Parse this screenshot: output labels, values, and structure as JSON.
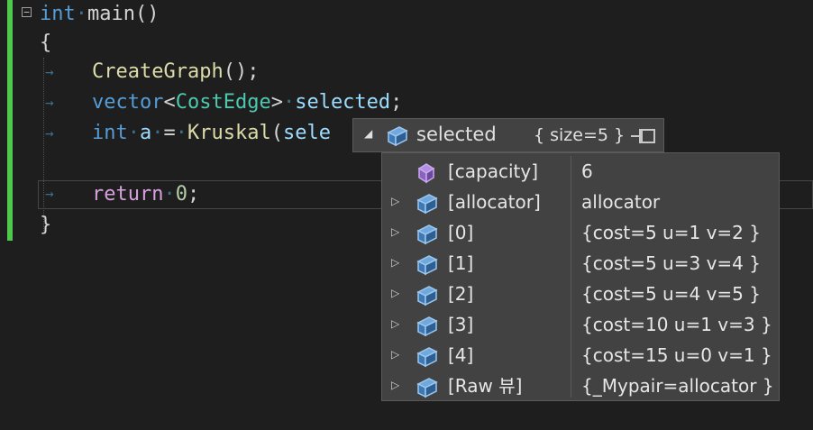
{
  "code": {
    "line1": {
      "kw": "int",
      "rest": "main()"
    },
    "line2": {
      "brace": "{"
    },
    "line3": {
      "call": "CreateGraph",
      "rest": "();"
    },
    "line4": {
      "kw": "vector",
      "lt": "<",
      "type": "CostEdge",
      "gt": ">",
      "var": "selected",
      "semi": ";"
    },
    "line5": {
      "kw": "int",
      "var": "a",
      "eq": "=",
      "fn": "Kruskal",
      "paren": "(",
      "arg": "sele"
    },
    "line6": {
      "kw": "return",
      "num": "0",
      "semi": ";"
    },
    "line7": {
      "brace": "}"
    }
  },
  "datatip": {
    "name": "selected",
    "summary": "{ size=5 }",
    "rows": [
      {
        "name": "[capacity]",
        "value": "6",
        "icon": "purple-cube-icon",
        "expandable": false
      },
      {
        "name": "[allocator]",
        "value": "allocator",
        "icon": "blue-cube-icon",
        "expandable": true
      },
      {
        "name": "[0]",
        "value": "{cost=5 u=1 v=2 }",
        "icon": "blue-cube-icon",
        "expandable": true
      },
      {
        "name": "[1]",
        "value": "{cost=5 u=3 v=4 }",
        "icon": "blue-cube-icon",
        "expandable": true
      },
      {
        "name": "[2]",
        "value": "{cost=5 u=4 v=5 }",
        "icon": "blue-cube-icon",
        "expandable": true
      },
      {
        "name": "[3]",
        "value": "{cost=10 u=1 v=3 }",
        "icon": "blue-cube-icon",
        "expandable": true
      },
      {
        "name": "[4]",
        "value": "{cost=15 u=0 v=1 }",
        "icon": "blue-cube-icon",
        "expandable": true
      },
      {
        "name": "[Raw 뷰]",
        "value": "{_Mypair=allocator }",
        "icon": "blue-cube-icon",
        "expandable": true
      }
    ]
  },
  "colors": {
    "keyword": "#569cd6",
    "function": "#dcdcaa",
    "type": "#4ec9b0",
    "variable": "#9cdcfe",
    "change_bar": "#4ec94e"
  }
}
